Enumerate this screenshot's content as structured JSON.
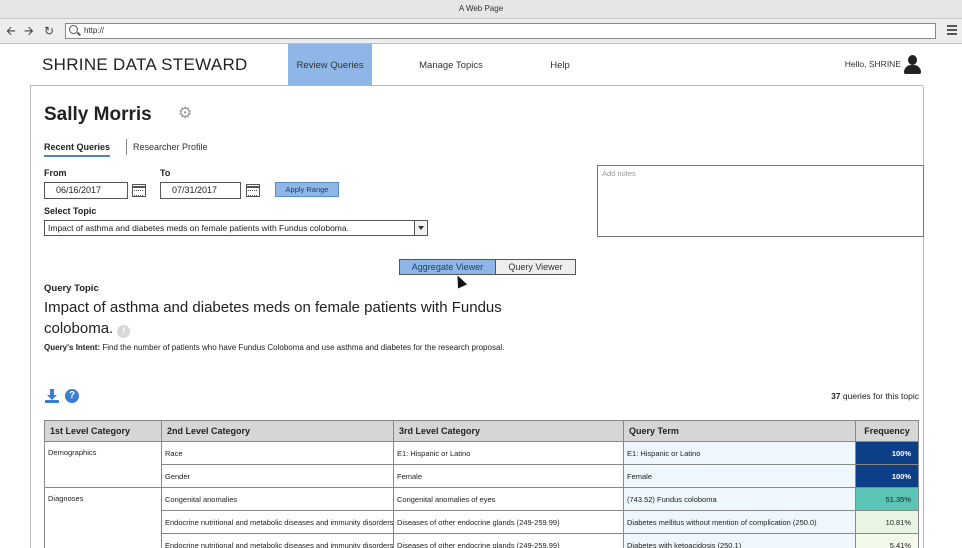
{
  "window": {
    "title": "A Web Page",
    "url": "http://"
  },
  "header": {
    "brand": "SHRINE DATA STEWARD",
    "nav": [
      {
        "label": "Review Queries",
        "active": true
      },
      {
        "label": "Manage Topics",
        "active": false
      },
      {
        "label": "Help",
        "active": false
      }
    ],
    "greeting": "Hello, SHRINE"
  },
  "profile": {
    "name": "Sally Morris",
    "tabs": [
      "Recent Queries",
      "Researcher Profile"
    ],
    "active_tab": "Recent Queries"
  },
  "filters": {
    "from_label": "From",
    "from_value": "06/16/2017",
    "to_label": "To",
    "to_value": "07/31/2017",
    "apply_label": "Apply Range",
    "topic_label": "Select Topic",
    "topic_value": "Impact of asthma and diabetes meds on female patients with Fundus coloboma."
  },
  "notes": {
    "placeholder": "Add notes"
  },
  "viewer": {
    "options": [
      "Aggregate Viewer",
      "Query Viewer"
    ],
    "selected": "Aggregate Viewer"
  },
  "query": {
    "topic_label": "Query Topic",
    "topic_title": "Impact of asthma and diabetes meds on female patients with Fundus coloboma.",
    "intent_label": "Query's Intent:",
    "intent_text": "Find the number of patients who have Fundus Coloboma and use asthma and diabetes for the research proposal.",
    "count_number": "37",
    "count_suffix": "queries for this topic"
  },
  "table": {
    "columns": [
      "1st Level Category",
      "2nd Level Category",
      "3rd Level Category",
      "Query Term",
      "Frequency"
    ],
    "rows": [
      {
        "c1": "Demographics",
        "c2": "Race",
        "c3": "E1: Hispanic or Latino",
        "c4": "E1: Hispanic or Latino",
        "freq": "100%",
        "color": "#0d3f86"
      },
      {
        "c1": "",
        "c2": "Gender",
        "c3": "Female",
        "c4": "Female",
        "freq": "100%",
        "color": "#0d3f86"
      },
      {
        "c1": "Diagnoses",
        "c2": "Congenital anomalies",
        "c3": "Congenital anomalies of eyes",
        "c4": "(743.52) Fundus coloboma",
        "freq": "51.35%",
        "color": "#5cc4b4"
      },
      {
        "c1": "",
        "c2": "Endocrine nutritional and metabolic diseases and immunity disorders",
        "c3": "Diseases of other endocrine glands (249-259.99)",
        "c4": "Diabetes mellitus without mention of complication (250.0)",
        "freq": "10.81%",
        "color": "#e9f5e3"
      },
      {
        "c1": "",
        "c2": "Endocrine nutritional and metabolic diseases and immunity disorders",
        "c3": "Diseases of other endocrine glands (249-259.99)",
        "c4": "Diabetes with ketoacidosis (250.1)",
        "freq": "5.41%",
        "color": "#f3f9e8"
      }
    ]
  }
}
